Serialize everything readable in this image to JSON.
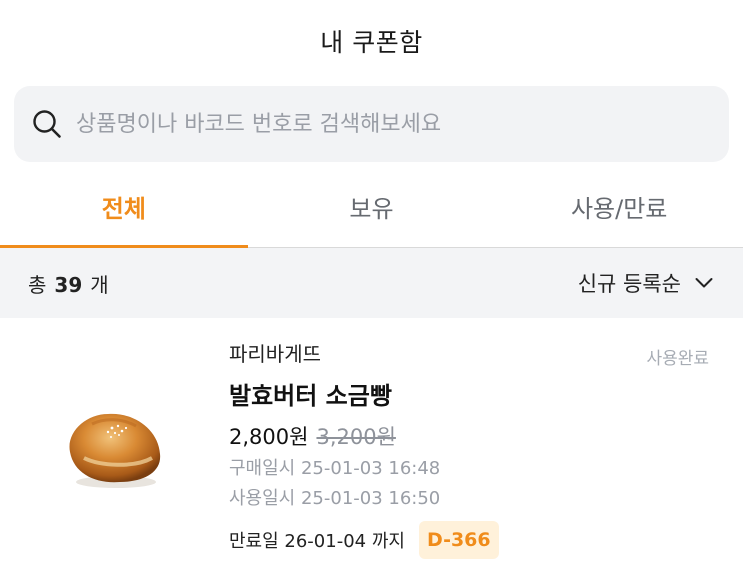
{
  "header": {
    "title": "내 쿠폰함"
  },
  "search": {
    "placeholder": "상품명이나 바코드 번호로 검색해보세요",
    "icon": "search-icon"
  },
  "tabs": [
    {
      "label": "전체",
      "active": true
    },
    {
      "label": "보유",
      "active": false
    },
    {
      "label": "사용/만료",
      "active": false
    }
  ],
  "list": {
    "count_prefix": "총",
    "count": "39",
    "count_suffix": "개",
    "sort_label": "신규 등록순"
  },
  "item": {
    "brand": "파리바게뜨",
    "status": "사용완료",
    "name": "발효버터 소금빵",
    "price": "2,800원",
    "original_price": "3,200원",
    "purchase_date": "구매일시 25-01-03 16:48",
    "use_date": "사용일시 25-01-03 16:50",
    "expire_label": "만료일 26-01-04 까지",
    "d_day": "D-366"
  },
  "colors": {
    "accent": "#f08c1b",
    "dday_bg": "#fff1da",
    "status_gray": "#a7acb4",
    "search_bg": "#f2f3f5"
  }
}
